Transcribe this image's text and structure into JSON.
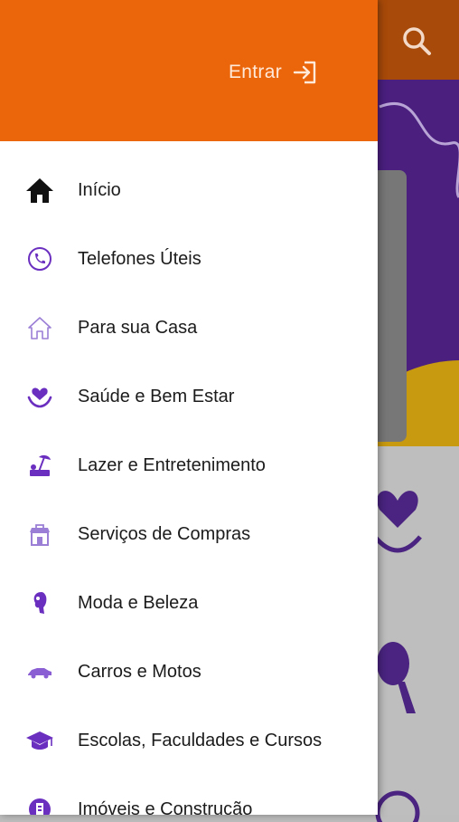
{
  "colors": {
    "header": "#eb650b",
    "accent": "#6b2fc0",
    "background_topbar": "#a84a09"
  },
  "header": {
    "login_label": "Entrar",
    "login_icon": "login-icon"
  },
  "background": {
    "search_icon": "search-icon"
  },
  "menu": {
    "items": [
      {
        "label": "Início",
        "icon": "home-icon"
      },
      {
        "label": "Telefones Úteis",
        "icon": "phone-icon"
      },
      {
        "label": "Para sua Casa",
        "icon": "house-outline-icon"
      },
      {
        "label": "Saúde e Bem Estar",
        "icon": "heart-hands-icon"
      },
      {
        "label": "Lazer e Entretenimento",
        "icon": "beach-icon"
      },
      {
        "label": "Serviços de Compras",
        "icon": "shop-icon"
      },
      {
        "label": "Moda e Beleza",
        "icon": "woman-face-icon"
      },
      {
        "label": "Carros e Motos",
        "icon": "car-icon"
      },
      {
        "label": "Escolas, Faculdades e Cursos",
        "icon": "graduation-cap-icon"
      },
      {
        "label": "Imóveis e Construção",
        "icon": "building-icon"
      }
    ]
  }
}
